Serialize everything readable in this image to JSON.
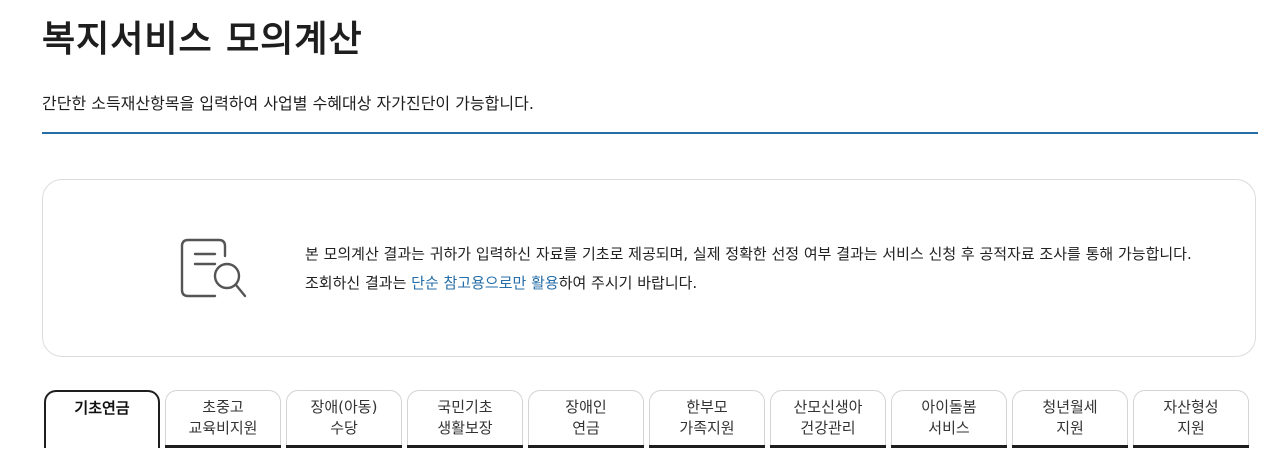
{
  "header": {
    "title": "복지서비스 모의계산",
    "subtitle": "간단한 소득재산항목을 입력하여 사업별 수혜대상 자가진단이 가능합니다."
  },
  "notice": {
    "icon": "document-search-icon",
    "text_before": "본 모의계산 결과는 귀하가 입력하신 자료를 기초로 제공되며, 실제 정확한 선정 여부 결과는 서비스 신청 후 공적자료 조사를 통해 가능합니다. 조회하신 결과는 ",
    "highlight": "단순 참고용으로만 활용",
    "text_after": "하여 주시기 바랍니다."
  },
  "tabs": [
    {
      "line1": "기초연금",
      "line2": ""
    },
    {
      "line1": "초중고",
      "line2": "교육비지원"
    },
    {
      "line1": "장애(아동)",
      "line2": "수당"
    },
    {
      "line1": "국민기초",
      "line2": "생활보장"
    },
    {
      "line1": "장애인",
      "line2": "연금"
    },
    {
      "line1": "한부모",
      "line2": "가족지원"
    },
    {
      "line1": "산모신생아",
      "line2": "건강관리"
    },
    {
      "line1": "아이돌봄",
      "line2": "서비스"
    },
    {
      "line1": "청년월세",
      "line2": "지원"
    },
    {
      "line1": "자산형성",
      "line2": "지원"
    }
  ],
  "active_tab": "기초연금",
  "colors": {
    "accent": "#256ea8",
    "text": "#1e1e1e"
  }
}
